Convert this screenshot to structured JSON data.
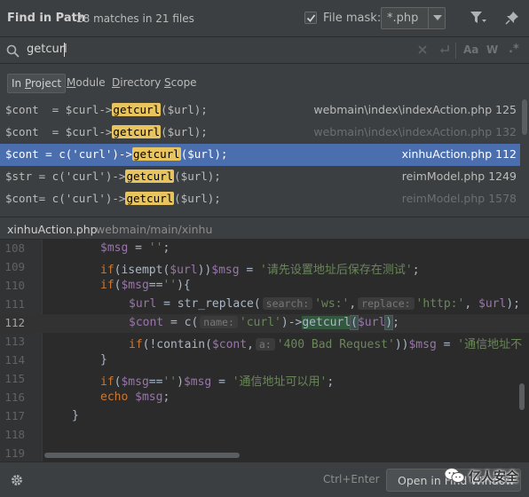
{
  "header": {
    "title": "Find in Path",
    "match_summary": "28 matches in 21 files",
    "file_mask_label": "File mask:",
    "file_mask_checked": true,
    "file_mask_value": "*.php"
  },
  "search": {
    "query": "getcurl",
    "case_label": "Aa",
    "word_label": "W",
    "regex_label": ".*"
  },
  "scope_tabs": [
    {
      "label": "In Project",
      "mnemonic": "P",
      "active": true
    },
    {
      "label": "Module",
      "mnemonic": "M"
    },
    {
      "label": "Directory",
      "mnemonic": "D"
    },
    {
      "label": "Scope",
      "mnemonic": "S"
    }
  ],
  "results": [
    {
      "before": "$cont  = $curl->",
      "match": "getcurl",
      "after": "($url);",
      "file": "webmain\\index\\indexAction.php",
      "line": "125",
      "dim": false,
      "selected": false
    },
    {
      "before": "$cont  = $curl->",
      "match": "getcurl",
      "after": "($url);",
      "file": "webmain\\index\\indexAction.php",
      "line": "132",
      "dim": true,
      "selected": false
    },
    {
      "before": "$cont = c('curl')->",
      "match": "getcurl",
      "after": "($url);",
      "file": "xinhuAction.php",
      "line": "112",
      "dim": false,
      "selected": true
    },
    {
      "before": "$str = c('curl')->",
      "match": "getcurl",
      "after": "($url);",
      "file": "reimModel.php",
      "line": "1249",
      "dim": false,
      "selected": false
    },
    {
      "before": "$cont= c('curl')->",
      "match": "getcurl",
      "after": "($url);",
      "file": "reimModel.php",
      "line": "1578",
      "dim": true,
      "selected": false
    }
  ],
  "preview": {
    "file_name": "xinhuAction.php",
    "file_path": "webmain/main/xinhu",
    "current_line": 112,
    "line_numbers": [
      "108",
      "109",
      "110",
      "111",
      "112",
      "113",
      "114",
      "115",
      "116",
      "117",
      "118",
      "119"
    ],
    "hints": {
      "search": "search:",
      "replace": "replace:",
      "name": "name:",
      "a": "a:"
    },
    "strings": {
      "empty": "''",
      "msg_set_url": "'请先设置地址后保存在测试'",
      "ws": "'ws:'",
      "http": "'http:'",
      "curl": "'curl'",
      "bad_request": "'400 Bad Request'",
      "unreachable": "'通信地址不",
      "ok": "'通信地址可以用'"
    }
  },
  "footer": {
    "shortcut": "Ctrl+Enter",
    "open_button": "Open in Find Window"
  },
  "watermark": {
    "text": "亿人安全"
  },
  "colors": {
    "background": "#3c3f41",
    "editor_bg": "#2b2b2b",
    "selection": "#4b6eaf",
    "match_highlight": "#e8c45f",
    "keyword": "#cc7832",
    "variable": "#9876aa",
    "string": "#6a8759"
  }
}
